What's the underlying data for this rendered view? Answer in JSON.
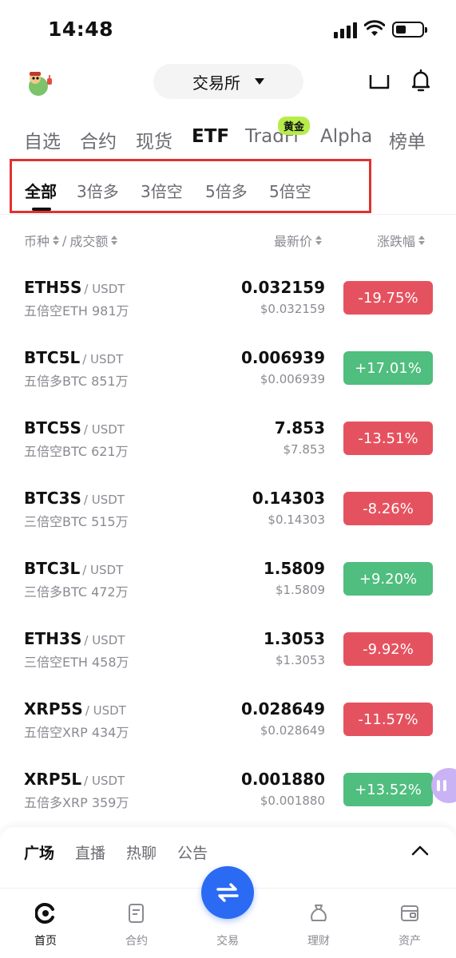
{
  "status_bar": {
    "time": "14:48"
  },
  "header": {
    "exchange_label": "交易所"
  },
  "main_tabs": [
    {
      "label": "自选"
    },
    {
      "label": "合约"
    },
    {
      "label": "现货"
    },
    {
      "label": "ETF"
    },
    {
      "label": "TradFi"
    },
    {
      "label": "Alpha"
    },
    {
      "label": "榜单"
    }
  ],
  "gold_badge": "黄金",
  "sub_tabs": [
    {
      "label": "全部"
    },
    {
      "label": "3倍多"
    },
    {
      "label": "3倍空"
    },
    {
      "label": "5倍多"
    },
    {
      "label": "5倍空"
    }
  ],
  "columns": {
    "pair": "币种",
    "separator": "/",
    "volume": "成交额",
    "last_price": "最新价",
    "change": "涨跌幅"
  },
  "rows": [
    {
      "base": "ETH5S",
      "quote": "/ USDT",
      "desc": "五倍空ETH 981万",
      "price": "0.032159",
      "fiat": "$0.032159",
      "change": "-19.75%",
      "dir": "down"
    },
    {
      "base": "BTC5L",
      "quote": "/ USDT",
      "desc": "五倍多BTC 851万",
      "price": "0.006939",
      "fiat": "$0.006939",
      "change": "+17.01%",
      "dir": "up"
    },
    {
      "base": "BTC5S",
      "quote": "/ USDT",
      "desc": "五倍空BTC 621万",
      "price": "7.853",
      "fiat": "$7.853",
      "change": "-13.51%",
      "dir": "down"
    },
    {
      "base": "BTC3S",
      "quote": "/ USDT",
      "desc": "三倍空BTC 515万",
      "price": "0.14303",
      "fiat": "$0.14303",
      "change": "-8.26%",
      "dir": "down"
    },
    {
      "base": "BTC3L",
      "quote": "/ USDT",
      "desc": "三倍多BTC 472万",
      "price": "1.5809",
      "fiat": "$1.5809",
      "change": "+9.20%",
      "dir": "up"
    },
    {
      "base": "ETH3S",
      "quote": "/ USDT",
      "desc": "三倍空ETH 458万",
      "price": "1.3053",
      "fiat": "$1.3053",
      "change": "-9.92%",
      "dir": "down"
    },
    {
      "base": "XRP5S",
      "quote": "/ USDT",
      "desc": "五倍空XRP 434万",
      "price": "0.028649",
      "fiat": "$0.028649",
      "change": "-11.57%",
      "dir": "down"
    },
    {
      "base": "XRP5L",
      "quote": "/ USDT",
      "desc": "五倍多XRP 359万",
      "price": "0.001880",
      "fiat": "$0.001880",
      "change": "+13.52%",
      "dir": "up"
    }
  ],
  "community_tabs": [
    {
      "label": "广场"
    },
    {
      "label": "直播"
    },
    {
      "label": "热聊"
    },
    {
      "label": "公告"
    }
  ],
  "bottom_nav": [
    {
      "label": "首页",
      "icon": "home-icon"
    },
    {
      "label": "合约",
      "icon": "futures-icon"
    },
    {
      "label": "交易",
      "icon": "trade-swap-icon"
    },
    {
      "label": "理财",
      "icon": "earn-icon"
    },
    {
      "label": "资产",
      "icon": "assets-icon"
    }
  ],
  "colors": {
    "up": "#4fbe7e",
    "down": "#e5525f",
    "accent": "#2b6bf3",
    "highlight_box": "#e03131",
    "gold_badge": "#b7ec4b"
  }
}
